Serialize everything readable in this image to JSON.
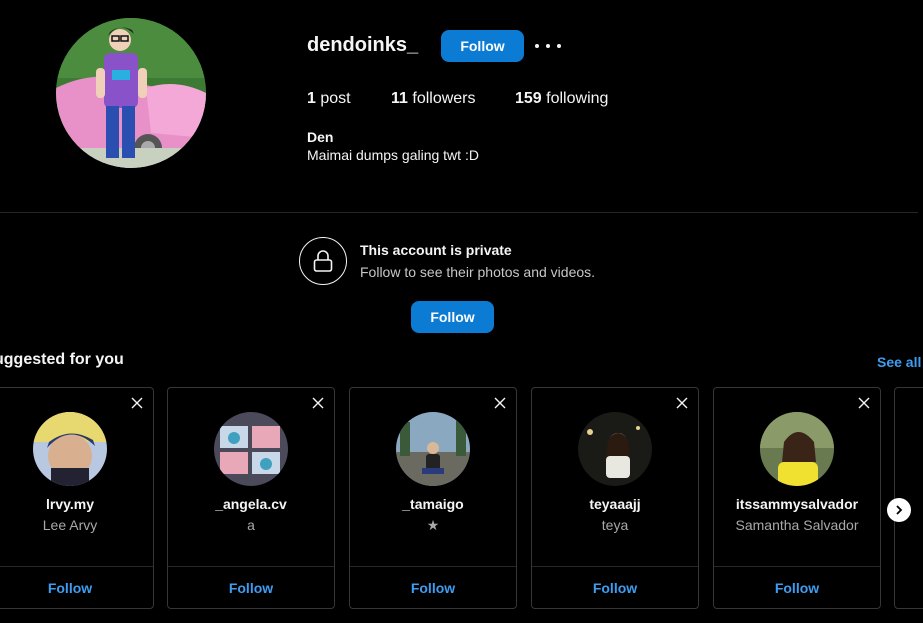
{
  "profile": {
    "username": "dendoinks_",
    "follow_label": "Follow",
    "stats": {
      "posts_count": "1",
      "posts_label": "post",
      "followers_count": "11",
      "followers_label": "followers",
      "following_count": "159",
      "following_label": "following"
    },
    "bio_name": "Den",
    "bio_text": "Maimai dumps galing twt :D"
  },
  "private_notice": {
    "title": "This account is private",
    "subtitle": "Follow to see their photos and videos.",
    "follow_label": "Follow"
  },
  "suggested": {
    "title": "uggested for you",
    "see_all": "See all",
    "cards": [
      {
        "username": "lrvy.my",
        "fullname": "Lee Arvy",
        "follow": "Follow"
      },
      {
        "username": "_angela.cv",
        "fullname": "a",
        "follow": "Follow"
      },
      {
        "username": "_tamaigo",
        "fullname": "★",
        "follow": "Follow"
      },
      {
        "username": "teyaaajj",
        "fullname": "teya",
        "follow": "Follow"
      },
      {
        "username": "itssammysalvador",
        "fullname": "Samantha Salvador",
        "follow": "Follow"
      }
    ]
  },
  "colors": {
    "background": "#000000",
    "primary_button": "#0c7bd4",
    "link": "#3e9df0",
    "border": "#363636"
  }
}
